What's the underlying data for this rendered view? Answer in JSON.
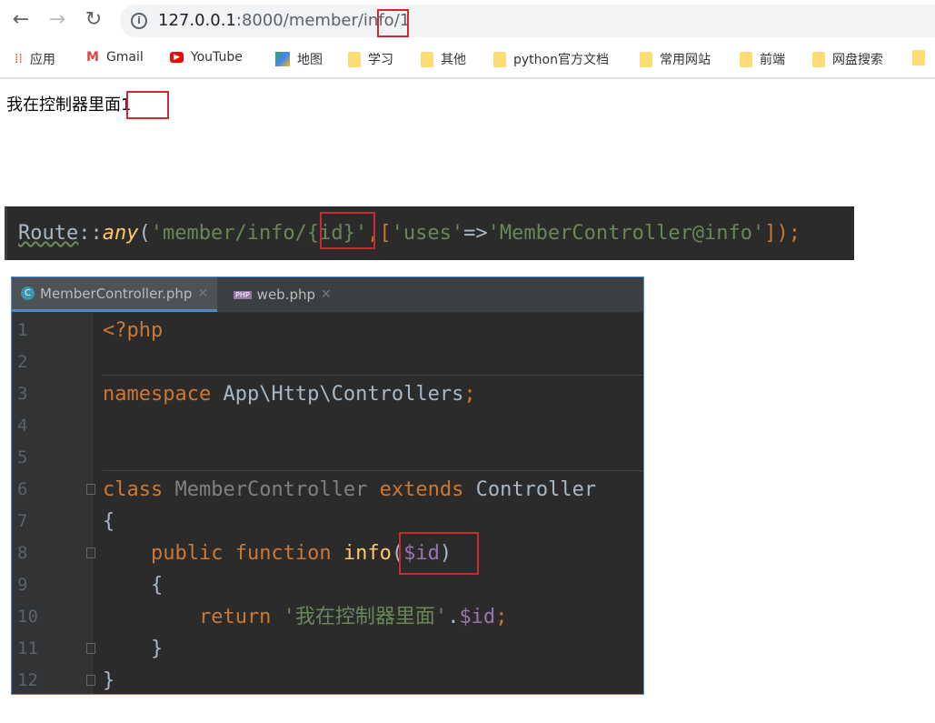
{
  "browser": {
    "url_host": "127.0.0.1",
    "url_port_path": ":8000/member/info/",
    "url_id": "1",
    "bookmarks": [
      {
        "label": "应用",
        "icon": "apps-icon"
      },
      {
        "label": "Gmail",
        "icon": "gmail-icon"
      },
      {
        "label": "YouTube",
        "icon": "youtube-icon"
      },
      {
        "label": "地图",
        "icon": "maps-icon"
      },
      {
        "label": "学习",
        "icon": "folder-icon"
      },
      {
        "label": "其他",
        "icon": "folder-icon"
      },
      {
        "label": "python官方文档",
        "icon": "folder-icon"
      },
      {
        "label": "常用网站",
        "icon": "folder-icon"
      },
      {
        "label": "前端",
        "icon": "folder-icon"
      },
      {
        "label": "网盘搜索",
        "icon": "folder-icon"
      }
    ]
  },
  "page": {
    "text": "我在控制器里面",
    "id": "1"
  },
  "route": {
    "cls": "Route",
    "sep": "::",
    "method": "any",
    "open": "(",
    "str1": "'member/info/",
    "param": "{id}",
    "str1end": "'",
    "comma": ",[",
    "k": "'uses'",
    "arrow": "=>",
    "v": "'MemberController@info'",
    "close": "]);"
  },
  "editor": {
    "tabs": [
      {
        "label": "MemberController.php",
        "active": true
      },
      {
        "label": "web.php",
        "active": false
      }
    ],
    "lines": [
      "1",
      "2",
      "3",
      "4",
      "5",
      "6",
      "7",
      "8",
      "9",
      "10",
      "11",
      "12"
    ],
    "code": {
      "php_open": "<?php",
      "ns_kw": "namespace",
      "ns": " App\\Http\\Controllers",
      "semi": ";",
      "class_kw": "class",
      "class_name": " MemberController ",
      "extends_kw": "extends",
      "parent": " Controller",
      "brace_open": "{",
      "public_kw": "    public",
      "function_kw": " function",
      "fn_name": " info",
      "paren_open": "(",
      "param": "$id",
      "paren_close": ")",
      "inner_open": "    {",
      "return_kw": "        return",
      "ret_str": " '我在控制器里面'",
      "dot": ".",
      "ret_var": "$id",
      "ret_semi": ";",
      "inner_close": "    }",
      "brace_close": "}"
    }
  }
}
